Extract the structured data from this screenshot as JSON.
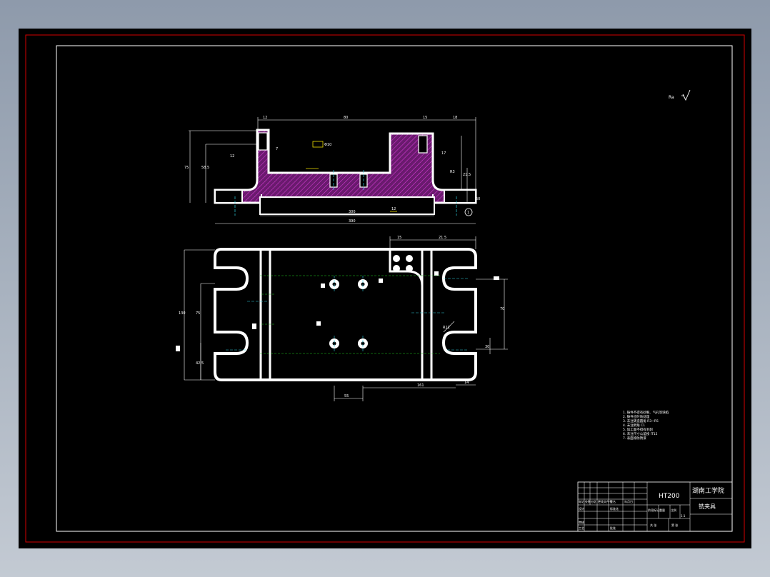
{
  "title_block": {
    "material": "HT200",
    "institution": "湖南工学院",
    "drawing_name": "铣夹具",
    "rows": {
      "header_labels": [
        "标记",
        "处数",
        "分区",
        "更改文件号",
        "签名",
        "年月日"
      ],
      "design_label": "设计",
      "standard_label": "标准化",
      "stage_label": "阶段标记",
      "weight_label": "重量",
      "scale_label": "比例",
      "review_label": "审核",
      "process_label": "工艺",
      "approve_label": "批准",
      "sheets_label": "共 张",
      "sheet_label": "第 张",
      "scale_value": "1:1"
    }
  },
  "notes": {
    "lines": [
      "1. 铸件不得有砂眼、气孔等缺陷",
      "2. 铸件应时效处理",
      "3. 未注铸造圆角 R3~R5",
      "4. 未注倒角 C1",
      "5. 加工面不得有毛刺",
      "6. 未注尺寸公差按 IT12",
      "7. 表面涂防锈漆"
    ]
  },
  "surface_symbol": "Ra",
  "section_view": {
    "dims": {
      "top_overall": "80",
      "top_left": "12",
      "top_right_a": "15",
      "top_right_b": "18",
      "height_total": "75",
      "height_inner": "58.5",
      "left_small_a": "12",
      "left_small_b": "7",
      "bore_label": "Φ10",
      "bottom_inner": "300",
      "bottom_overall": "390",
      "right_h_a": "17",
      "right_h_b": "21.5",
      "right_h_c": "50",
      "right_angle": "R3",
      "bottom_mark": "12",
      "balloon": "1"
    }
  },
  "plan_view": {
    "dims": {
      "top_a": "15",
      "top_b": "21.5",
      "left_total": "130",
      "left_mid": "75",
      "left_low": "42.5",
      "right_a": "70",
      "right_b": "30",
      "bottom_a": "55",
      "bottom_b": "161",
      "bottom_c": "14",
      "radius": "R12"
    }
  }
}
